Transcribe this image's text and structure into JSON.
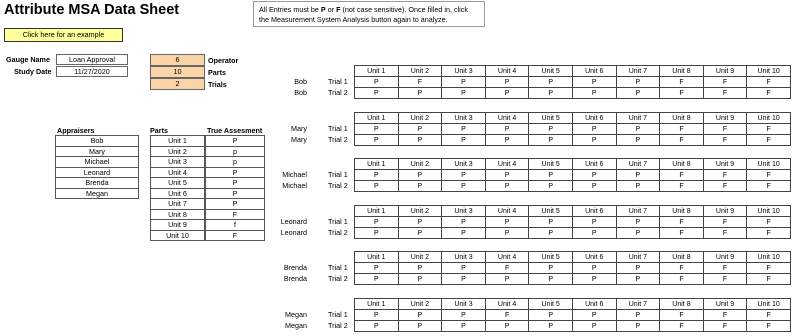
{
  "title": "Attribute MSA Data Sheet",
  "note": {
    "pre1": "All Entries must be ",
    "p": "P",
    "or": " or ",
    "f": "F",
    "post": " (not case sensitive). Once filled in, click the Measurement System Analysis button again to analyze."
  },
  "example_button": "Click here for an example",
  "gauge": {
    "name_label": "Gauge Name",
    "name_value": "Loan Approval",
    "date_label": "Study Date",
    "date_value": "11/27/2020"
  },
  "settings": [
    {
      "value": "6",
      "label": "Operator"
    },
    {
      "value": "10",
      "label": "Parts"
    },
    {
      "value": "2",
      "label": "Trials"
    }
  ],
  "appraisers_header": "Appraisers",
  "appraisers": [
    "Bob",
    "Mary",
    "Michael",
    "Leonard",
    "Brenda",
    "Megan"
  ],
  "parts_header": "Parts",
  "true_header": "True Assesment",
  "parts": [
    {
      "part": "Unit 1",
      "true": "P"
    },
    {
      "part": "Unit 2",
      "true": "p"
    },
    {
      "part": "Unit 3",
      "true": "p"
    },
    {
      "part": "Unit 4",
      "true": "P"
    },
    {
      "part": "Unit 5",
      "true": "P"
    },
    {
      "part": "Unit 6",
      "true": "P"
    },
    {
      "part": "Unit 7",
      "true": "P"
    },
    {
      "part": "Unit 8",
      "true": "F"
    },
    {
      "part": "Unit 9",
      "true": "f"
    },
    {
      "part": "Unit 10",
      "true": "F"
    }
  ],
  "units": [
    "Unit 1",
    "Unit 2",
    "Unit 3",
    "Unit 4",
    "Unit 5",
    "Unit 6",
    "Unit 7",
    "Unit 8",
    "Unit 9",
    "Unit 10"
  ],
  "trial_labels": [
    "Trial 1",
    "Trial 2"
  ],
  "blocks": [
    {
      "operator": "Bob",
      "trials": [
        [
          "P",
          "F",
          "P",
          "P",
          "P",
          "P",
          "P",
          "F",
          "F",
          "F"
        ],
        [
          "P",
          "P",
          "P",
          "P",
          "P",
          "P",
          "P",
          "F",
          "F",
          "F"
        ]
      ]
    },
    {
      "operator": "Mary",
      "trials": [
        [
          "P",
          "P",
          "P",
          "P",
          "P",
          "P",
          "P",
          "F",
          "F",
          "F"
        ],
        [
          "P",
          "P",
          "P",
          "P",
          "P",
          "P",
          "P",
          "F",
          "F",
          "F"
        ]
      ]
    },
    {
      "operator": "Michael",
      "trials": [
        [
          "P",
          "P",
          "P",
          "P",
          "P",
          "P",
          "P",
          "F",
          "F",
          "F"
        ],
        [
          "P",
          "P",
          "P",
          "P",
          "P",
          "P",
          "P",
          "F",
          "F",
          "F"
        ]
      ]
    },
    {
      "operator": "Leonard",
      "trials": [
        [
          "P",
          "P",
          "P",
          "P",
          "P",
          "P",
          "P",
          "F",
          "F",
          "F"
        ],
        [
          "P",
          "P",
          "P",
          "P",
          "P",
          "P",
          "P",
          "F",
          "F",
          "F"
        ]
      ]
    },
    {
      "operator": "Brenda",
      "trials": [
        [
          "P",
          "P",
          "P",
          "F",
          "P",
          "P",
          "P",
          "F",
          "F",
          "F"
        ],
        [
          "P",
          "P",
          "P",
          "P",
          "P",
          "P",
          "P",
          "F",
          "F",
          "F"
        ]
      ]
    },
    {
      "operator": "Megan",
      "trials": [
        [
          "P",
          "P",
          "P",
          "F",
          "P",
          "P",
          "P",
          "F",
          "F",
          "F"
        ],
        [
          "P",
          "P",
          "P",
          "P",
          "P",
          "P",
          "P",
          "F",
          "F",
          "F"
        ]
      ]
    }
  ]
}
